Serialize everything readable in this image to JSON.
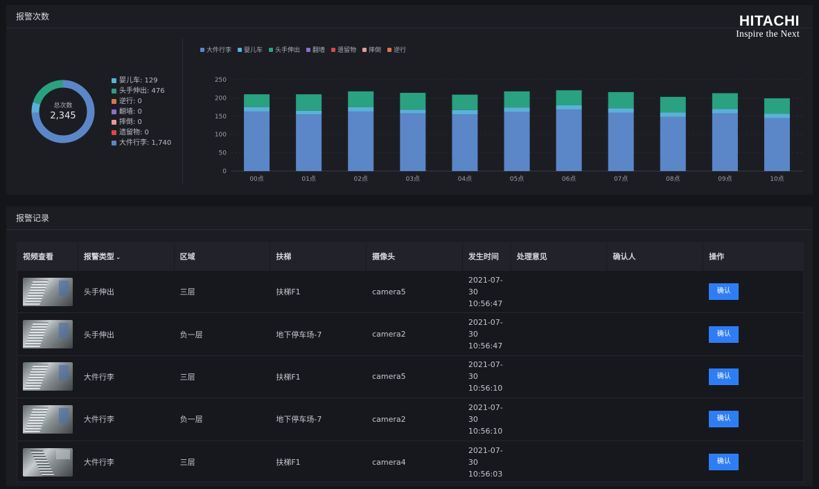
{
  "stats_panel": {
    "title": "报警次数",
    "total_label": "总次数",
    "total_value": "2,345",
    "legend": [
      {
        "text": "婴儿车: 129",
        "color": "#5ab1d8"
      },
      {
        "text": "头手伸出: 476",
        "color": "#2aa181"
      },
      {
        "text": "逆行: 0",
        "color": "#e0744d"
      },
      {
        "text": "翻墙: 0",
        "color": "#8a6fd4"
      },
      {
        "text": "摔倒: 0",
        "color": "#e49a9a"
      },
      {
        "text": "遗留物: 0",
        "color": "#e04646"
      },
      {
        "text": "大件行李: 1,740",
        "color": "#5b87c9"
      }
    ]
  },
  "logo": {
    "name": "HITACHI",
    "tagline": "Inspire the Next"
  },
  "chart_data": {
    "type": "bar",
    "stacked": true,
    "categories": [
      "00点",
      "01点",
      "02点",
      "03点",
      "04点",
      "05点",
      "06点",
      "07点",
      "08点",
      "09点",
      "10点"
    ],
    "yticks": [
      "250",
      "200",
      "150",
      "100",
      "50",
      "0"
    ],
    "ylim": [
      0,
      250
    ],
    "grid": true,
    "legend_position": "top-left",
    "legend": [
      {
        "name": "大件行李",
        "color": "#5b87c9"
      },
      {
        "name": "婴儿车",
        "color": "#5ab1d8"
      },
      {
        "name": "头手伸出",
        "color": "#2aa181"
      },
      {
        "name": "翻墙",
        "color": "#8a6fd4"
      },
      {
        "name": "遗留物",
        "color": "#e04646"
      },
      {
        "name": "摔倒",
        "color": "#e49a9a"
      },
      {
        "name": "逆行",
        "color": "#e0744d"
      }
    ],
    "series": [
      {
        "name": "大件行李",
        "color": "#5b87c9",
        "values": [
          163,
          155,
          163,
          158,
          155,
          162,
          168,
          160,
          148,
          158,
          145
        ]
      },
      {
        "name": "婴儿车",
        "color": "#5ab1d8",
        "values": [
          12,
          10,
          12,
          10,
          12,
          12,
          12,
          12,
          12,
          12,
          12
        ]
      },
      {
        "name": "头手伸出",
        "color": "#2aa181",
        "values": [
          35,
          45,
          43,
          46,
          42,
          44,
          41,
          44,
          43,
          43,
          42
        ]
      }
    ]
  },
  "records_panel": {
    "title": "报警记录",
    "columns": [
      "视频查看",
      "报警类型",
      "区域",
      "扶梯",
      "摄像头",
      "发生时间",
      "处理意见",
      "确认人",
      "操作"
    ],
    "type_sort_icon": "⌄",
    "rows": [
      {
        "type": "头手伸出",
        "area": "三层",
        "escalator": "扶梯F1",
        "camera": "camera5",
        "date": "2021-07-30",
        "time": "10:56:47",
        "opinion": "",
        "confirmer": "",
        "action": "确认"
      },
      {
        "type": "头手伸出",
        "area": "负一层",
        "escalator": "地下停车场-7",
        "camera": "camera2",
        "date": "2021-07-30",
        "time": "10:56:47",
        "opinion": "",
        "confirmer": "",
        "action": "确认"
      },
      {
        "type": "大件行李",
        "area": "三层",
        "escalator": "扶梯F1",
        "camera": "camera5",
        "date": "2021-07-30",
        "time": "10:56:10",
        "opinion": "",
        "confirmer": "",
        "action": "确认"
      },
      {
        "type": "大件行李",
        "area": "负一层",
        "escalator": "地下停车场-7",
        "camera": "camera2",
        "date": "2021-07-30",
        "time": "10:56:10",
        "opinion": "",
        "confirmer": "",
        "action": "确认"
      },
      {
        "type": "大件行李",
        "area": "三层",
        "escalator": "扶梯F1",
        "camera": "camera4",
        "date": "2021-07-30",
        "time": "10:56:03",
        "opinion": "",
        "confirmer": "",
        "action": "确认"
      }
    ]
  }
}
